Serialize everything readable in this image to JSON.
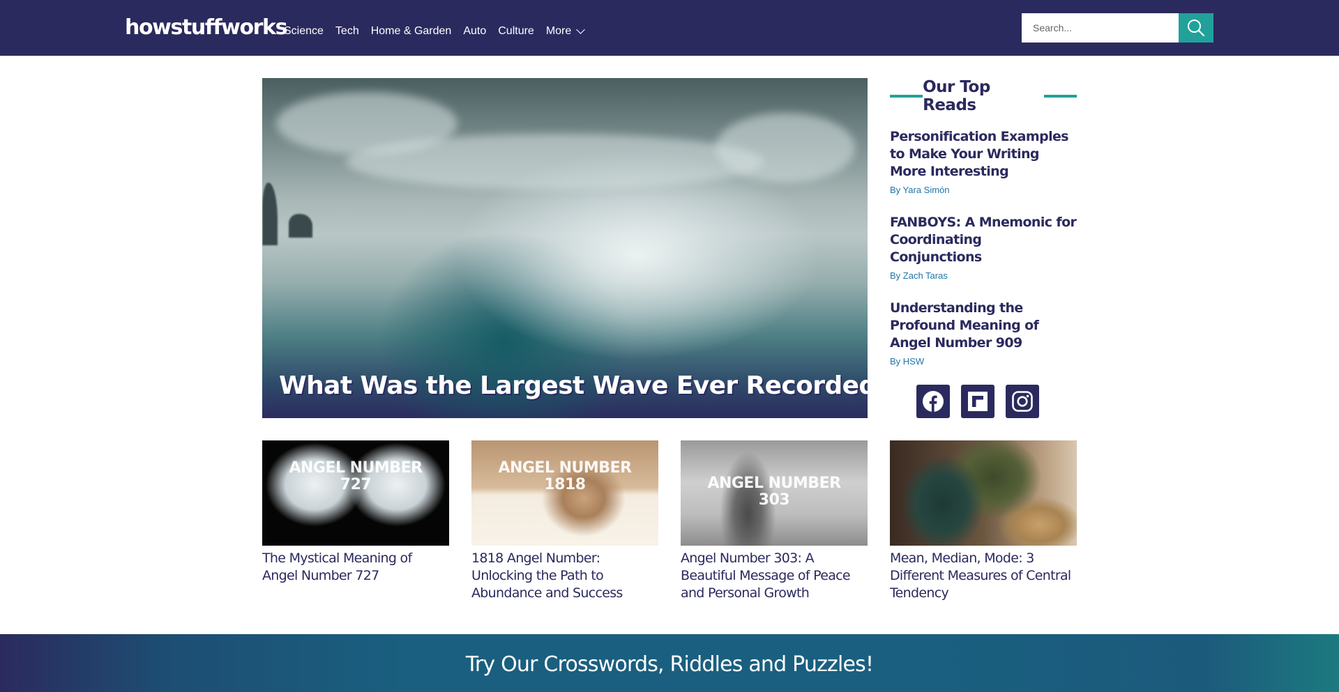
{
  "header": {
    "logo_text": "howstuffworks",
    "nav": [
      "Science",
      "Tech",
      "Home & Garden",
      "Auto",
      "Culture"
    ],
    "more_label": "More",
    "search": {
      "placeholder": "Search...",
      "value": "",
      "button_icon": "search-icon"
    },
    "colors": {
      "background": "#2b2a5e",
      "accent": "#21a19a"
    }
  },
  "hero": {
    "title": "What Was the Largest Wave Ever Recorded?",
    "image": "giant-ocean-wave-photo"
  },
  "sidebar": {
    "heading": "Our Top Reads",
    "items": [
      {
        "title": "Personification Examples to Make Your Writing More Interesting",
        "author": "By Yara Simón"
      },
      {
        "title": "FANBOYS: A Mnemonic for Coordinating Conjunctions",
        "author": "By Zach Taras"
      },
      {
        "title": "Understanding the Profound Meaning of Angel Number 909",
        "author": "By HSW"
      }
    ],
    "socials": [
      "facebook-icon",
      "flipboard-icon",
      "instagram-icon"
    ]
  },
  "cards": [
    {
      "title": "The Mystical Meaning of Angel Number 727",
      "image_text_line1": "ANGEL NUMBER",
      "image_text_line2": "727"
    },
    {
      "title": "1818 Angel Number: Unlocking the Path to Abundance and Success",
      "image_text_line1": "ANGEL NUMBER",
      "image_text_line2": "1818"
    },
    {
      "title": "Angel Number 303: A Beautiful Message of Peace and Personal Growth",
      "image_text_line1": "ANGEL NUMBER",
      "image_text_line2": "303"
    },
    {
      "title": "Mean, Median, Mode: 3 Different Measures of Central Tendency",
      "image_text_line1": "",
      "image_text_line2": ""
    }
  ],
  "banner": {
    "text": "Try Our Crosswords, Riddles and Puzzles!"
  }
}
